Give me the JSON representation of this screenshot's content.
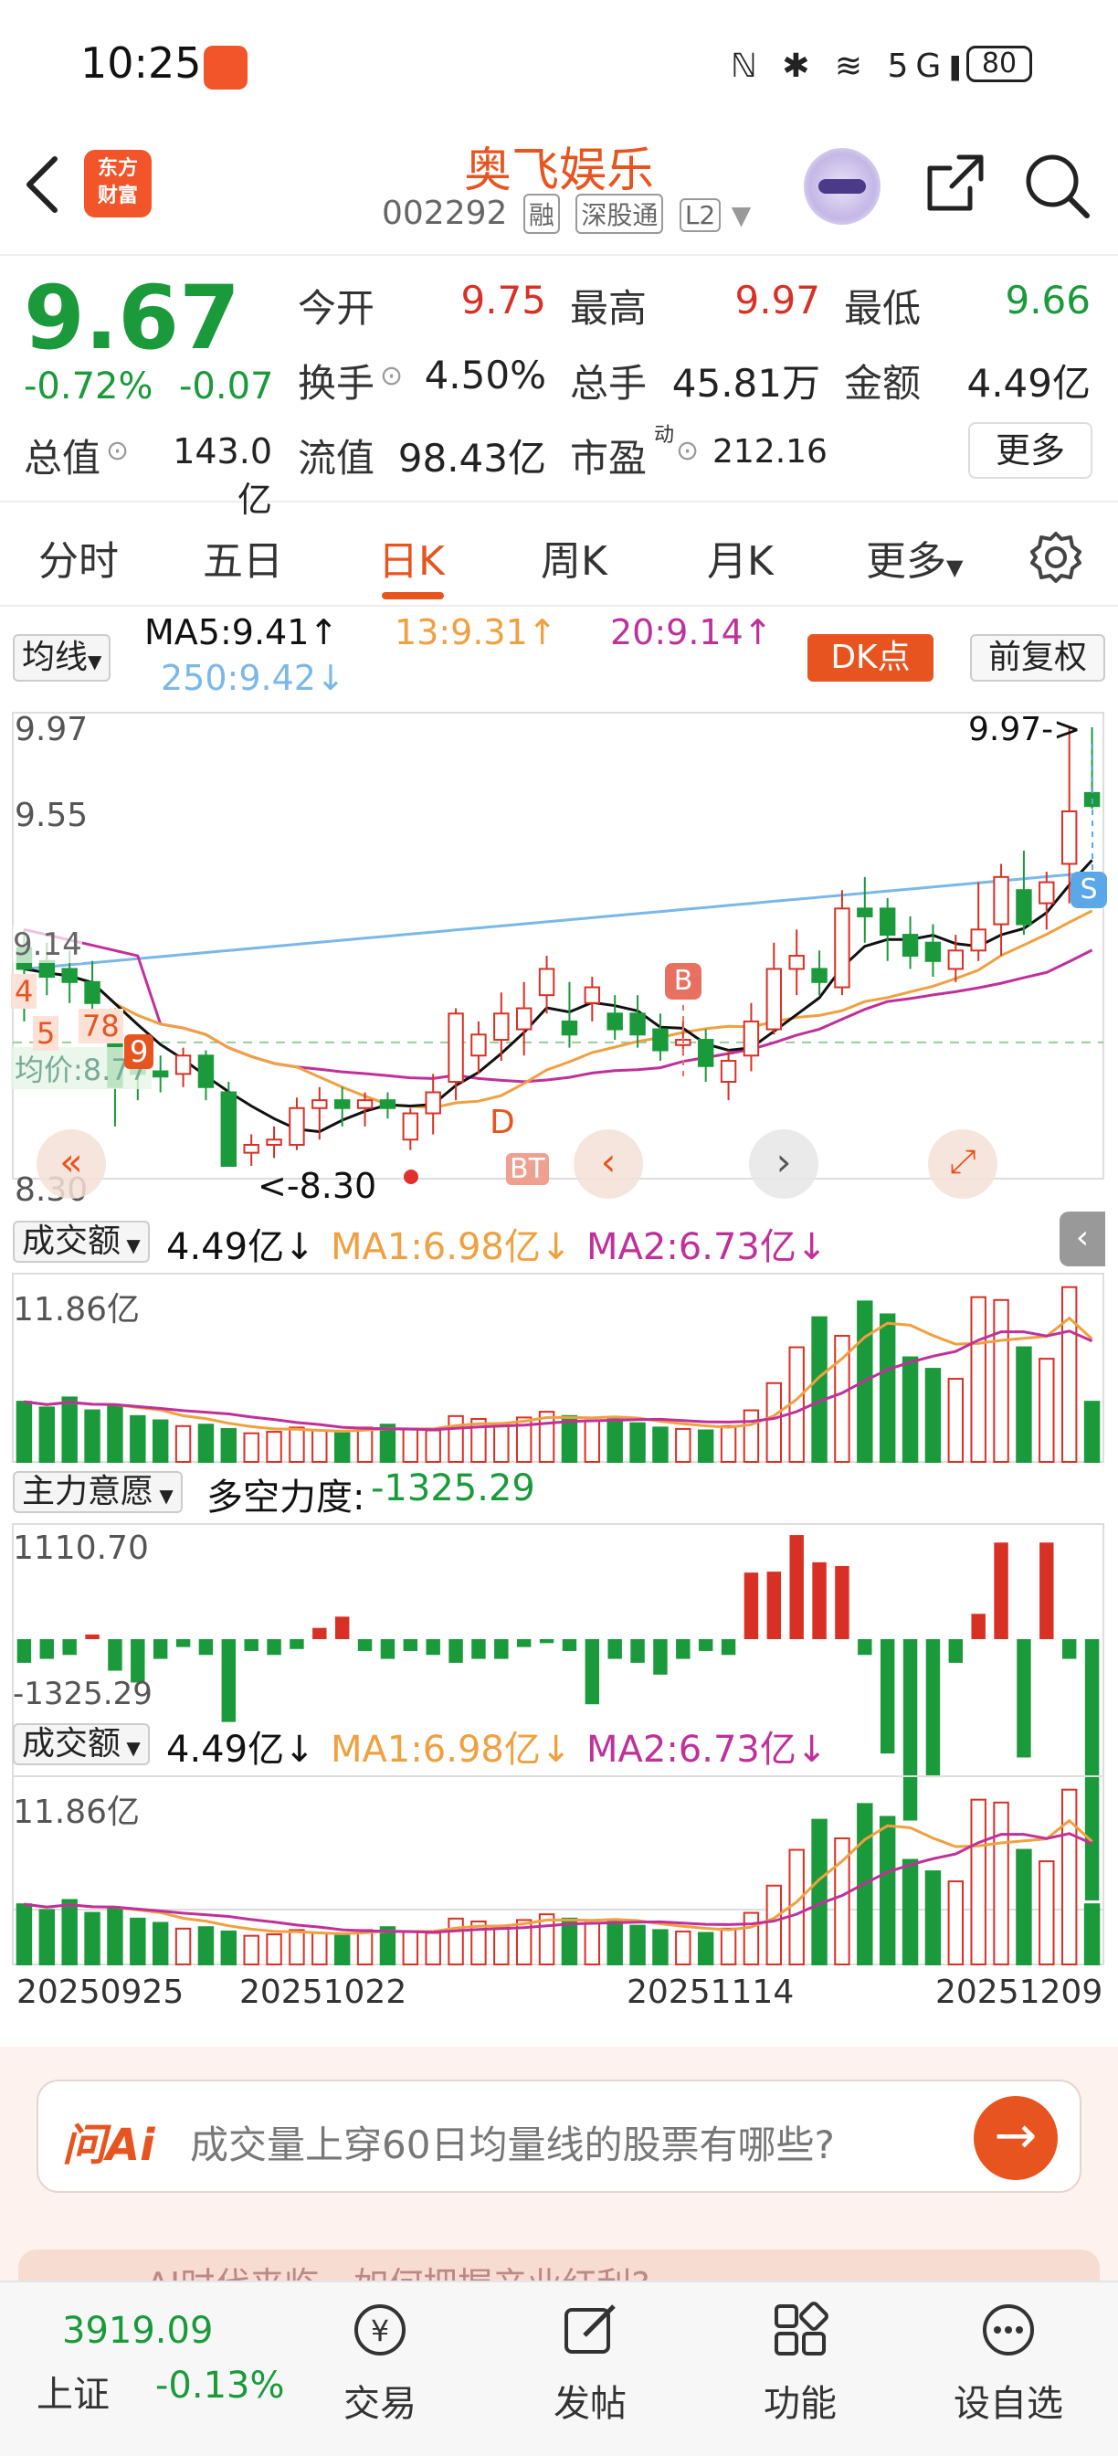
{
  "status_bar": {
    "time": "10:25",
    "battery": "80"
  },
  "header": {
    "stock_name": "奥飞娱乐",
    "stock_code": "002292",
    "tags": [
      "融",
      "深股通",
      "L2"
    ],
    "logo_line1": "东方",
    "logo_line2": "财富"
  },
  "quote": {
    "price": "9.67",
    "change_pct": "-0.72%",
    "change_amt": "-0.07",
    "fields": {
      "open_label": "今开",
      "open": "9.75",
      "high_label": "最高",
      "high": "9.97",
      "low_label": "最低",
      "low": "9.66",
      "turnover_label": "换手",
      "turnover": "4.50%",
      "volume_label": "总手",
      "volume": "45.81万",
      "amount_label": "金额",
      "amount": "4.49亿",
      "mktcap_label": "总值",
      "mktcap": "143.0亿",
      "float_label": "流值",
      "float": "98.43亿",
      "pe_label": "市盈",
      "pe_sup": "动",
      "pe": "212.16"
    },
    "more_label": "更多"
  },
  "tabs": [
    "分时",
    "五日",
    "日K",
    "周K",
    "月K",
    "更多"
  ],
  "active_tab": "日K",
  "ma_row": {
    "select": "均线",
    "ma5": "MA5:9.41↑",
    "ma13": "13:9.31↑",
    "ma20": "20:9.14↑",
    "ma250": "250:9.42↓",
    "dk_label": "DK点",
    "fq_label": "前复权"
  },
  "kline": {
    "y_high_label": "9.97",
    "y_mid_label": "9.55",
    "y_low_label": "8.30",
    "max_marker": "9.97",
    "min_marker": "8.30",
    "avg_price_label": "均价:8.77",
    "marker_b": "B",
    "marker_s": "S",
    "marker_d": "D",
    "marker_bt": "BT",
    "side_labels": [
      "9.14",
      "4",
      "5",
      "78",
      "9"
    ]
  },
  "volume1": {
    "select": "成交额",
    "value": "4.49亿↓",
    "ma1": "MA1:6.98亿↓",
    "ma2": "MA2:6.73亿↓",
    "max_label": "11.86亿"
  },
  "force": {
    "select": "主力意愿",
    "label": "多空力度:",
    "value": "-1325.29",
    "max_label": "1110.70",
    "min_label": "-1325.29"
  },
  "volume2": {
    "select": "成交额",
    "value": "4.49亿↓",
    "ma1": "MA1:6.98亿↓",
    "ma2": "MA2:6.73亿↓",
    "max_label": "11.86亿"
  },
  "dates": [
    "20250925",
    "20251022",
    "20251114",
    "20251209"
  ],
  "ai": {
    "logo": "问Ai",
    "prompt": "成交量上穿60日均量线的股票有哪些?",
    "banner": "AI时代来临，如何把握产业红利?"
  },
  "bottom": {
    "index_value": "3919.09",
    "index_name": "上证",
    "index_change": "-0.13%",
    "nav": [
      "交易",
      "发帖",
      "功能",
      "设自选"
    ]
  },
  "colors": {
    "accent": "#e8541f",
    "up": "#d93025",
    "down": "#1a9a3a",
    "ma5": "#111111",
    "ma13": "#f0a040",
    "ma20": "#c0309a",
    "ma250": "#7ab8e8"
  },
  "chart_data": {
    "type": "candlestick",
    "ylim": [
      8.3,
      9.97
    ],
    "candles": [
      {
        "o": 9.13,
        "c": 9.05,
        "h": 9.2,
        "l": 8.85
      },
      {
        "o": 9.08,
        "c": 9.02,
        "h": 9.15,
        "l": 8.95
      },
      {
        "o": 9.05,
        "c": 9.0,
        "h": 9.12,
        "l": 8.92
      },
      {
        "o": 9.0,
        "c": 8.92,
        "h": 9.08,
        "l": 8.8
      },
      {
        "o": 8.85,
        "c": 8.6,
        "h": 8.9,
        "l": 8.45
      },
      {
        "o": 8.72,
        "c": 8.65,
        "h": 8.78,
        "l": 8.55
      },
      {
        "o": 8.66,
        "c": 8.64,
        "h": 8.72,
        "l": 8.58
      },
      {
        "o": 8.65,
        "c": 8.72,
        "h": 8.75,
        "l": 8.6
      },
      {
        "o": 8.72,
        "c": 8.6,
        "h": 8.74,
        "l": 8.55
      },
      {
        "o": 8.58,
        "c": 8.3,
        "h": 8.62,
        "l": 8.3
      },
      {
        "o": 8.35,
        "c": 8.38,
        "h": 8.42,
        "l": 8.3
      },
      {
        "o": 8.38,
        "c": 8.4,
        "h": 8.45,
        "l": 8.33
      },
      {
        "o": 8.38,
        "c": 8.52,
        "h": 8.56,
        "l": 8.36
      },
      {
        "o": 8.52,
        "c": 8.55,
        "h": 8.6,
        "l": 8.4
      },
      {
        "o": 8.55,
        "c": 8.52,
        "h": 8.6,
        "l": 8.45
      },
      {
        "o": 8.52,
        "c": 8.55,
        "h": 8.58,
        "l": 8.45
      },
      {
        "o": 8.55,
        "c": 8.52,
        "h": 8.58,
        "l": 8.48
      },
      {
        "o": 8.4,
        "c": 8.5,
        "h": 8.52,
        "l": 8.36
      },
      {
        "o": 8.5,
        "c": 8.58,
        "h": 8.65,
        "l": 8.42
      },
      {
        "o": 8.62,
        "c": 8.88,
        "h": 8.9,
        "l": 8.55
      },
      {
        "o": 8.72,
        "c": 8.8,
        "h": 8.85,
        "l": 8.65
      },
      {
        "o": 8.78,
        "c": 8.88,
        "h": 8.96,
        "l": 8.7
      },
      {
        "o": 8.82,
        "c": 8.9,
        "h": 9.0,
        "l": 8.72
      },
      {
        "o": 8.95,
        "c": 9.05,
        "h": 9.1,
        "l": 8.88
      },
      {
        "o": 8.85,
        "c": 8.8,
        "h": 9.0,
        "l": 8.75
      },
      {
        "o": 8.92,
        "c": 8.98,
        "h": 9.02,
        "l": 8.85
      },
      {
        "o": 8.88,
        "c": 8.82,
        "h": 8.95,
        "l": 8.78
      },
      {
        "o": 8.88,
        "c": 8.8,
        "h": 8.95,
        "l": 8.75
      },
      {
        "o": 8.82,
        "c": 8.74,
        "h": 8.88,
        "l": 8.7
      },
      {
        "o": 8.76,
        "c": 8.78,
        "h": 8.85,
        "l": 8.72
      },
      {
        "o": 8.78,
        "c": 8.68,
        "h": 8.82,
        "l": 8.62
      },
      {
        "o": 8.62,
        "c": 8.7,
        "h": 8.74,
        "l": 8.55
      },
      {
        "o": 8.72,
        "c": 8.85,
        "h": 8.92,
        "l": 8.66
      },
      {
        "o": 8.82,
        "c": 9.05,
        "h": 9.15,
        "l": 8.8
      },
      {
        "o": 9.05,
        "c": 9.1,
        "h": 9.2,
        "l": 8.95
      },
      {
        "o": 9.05,
        "c": 9.0,
        "h": 9.12,
        "l": 8.95
      },
      {
        "o": 8.98,
        "c": 9.28,
        "h": 9.35,
        "l": 8.95
      },
      {
        "o": 9.28,
        "c": 9.25,
        "h": 9.4,
        "l": 9.15
      },
      {
        "o": 9.28,
        "c": 9.18,
        "h": 9.32,
        "l": 9.08
      },
      {
        "o": 9.18,
        "c": 9.1,
        "h": 9.25,
        "l": 9.05
      },
      {
        "o": 9.15,
        "c": 9.08,
        "h": 9.22,
        "l": 9.02
      },
      {
        "o": 9.05,
        "c": 9.12,
        "h": 9.18,
        "l": 9.0
      },
      {
        "o": 9.12,
        "c": 9.2,
        "h": 9.38,
        "l": 9.08
      },
      {
        "o": 9.22,
        "c": 9.4,
        "h": 9.45,
        "l": 9.1
      },
      {
        "o": 9.35,
        "c": 9.22,
        "h": 9.5,
        "l": 9.18
      },
      {
        "o": 9.3,
        "c": 9.38,
        "h": 9.42,
        "l": 9.2
      },
      {
        "o": 9.45,
        "c": 9.65,
        "h": 9.97,
        "l": 9.3
      },
      {
        "o": 9.72,
        "c": 9.67,
        "h": 9.97,
        "l": 9.66
      }
    ]
  }
}
